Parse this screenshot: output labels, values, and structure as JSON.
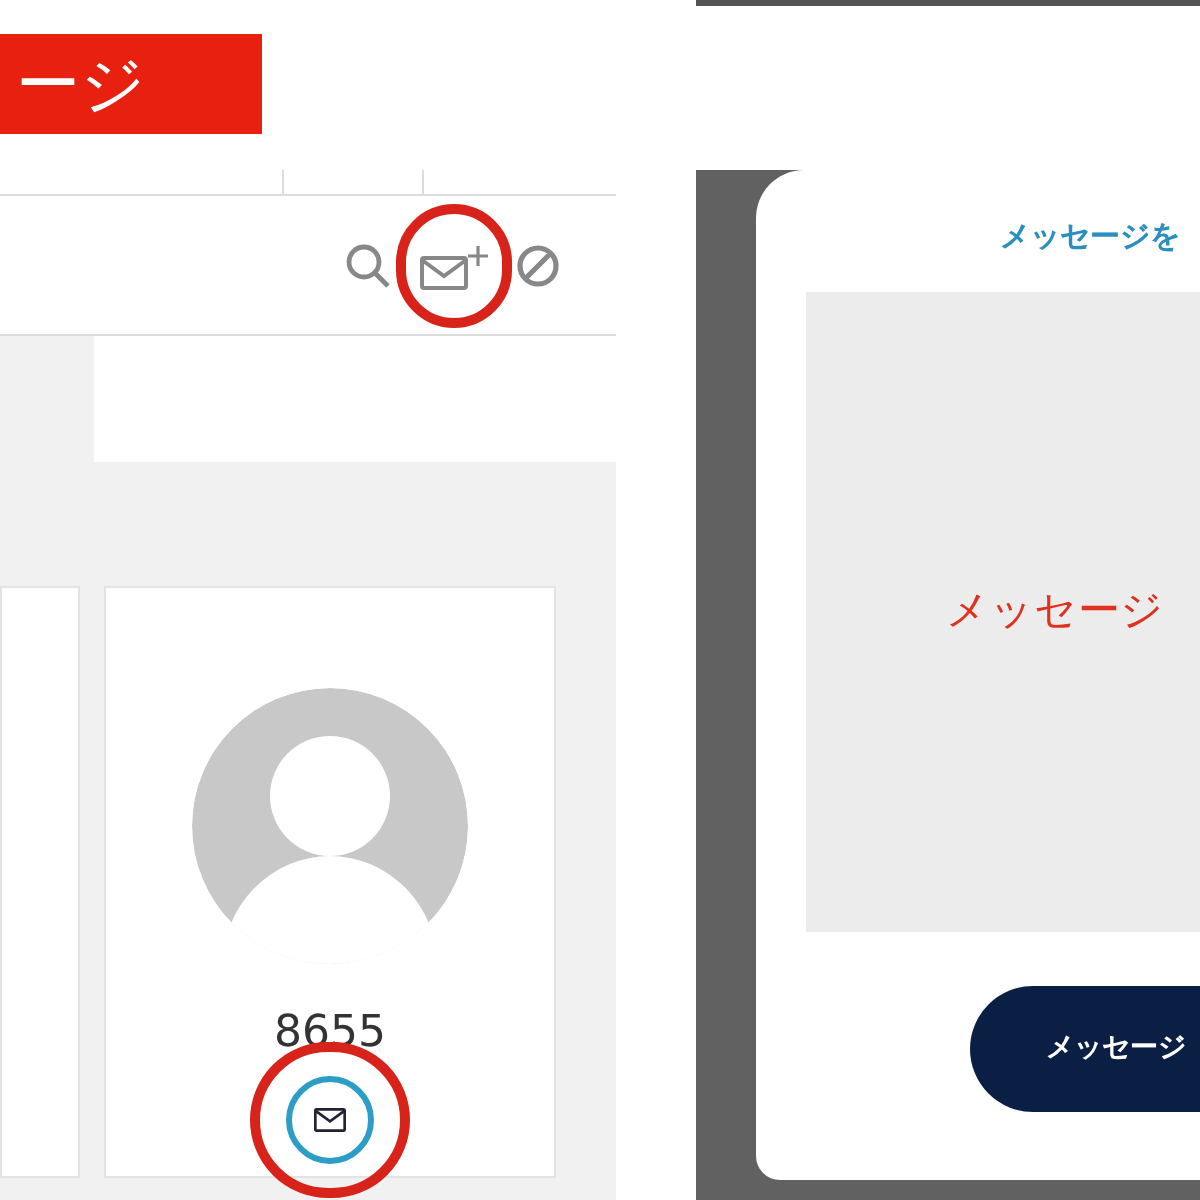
{
  "banner": {
    "text": "ージ"
  },
  "members": [
    {
      "kind": "partial"
    },
    {
      "kind": "full",
      "number": "8655"
    }
  ],
  "modal": {
    "title": "メッセージを",
    "preview_text": "メッセージ",
    "button": "メッセージ"
  }
}
